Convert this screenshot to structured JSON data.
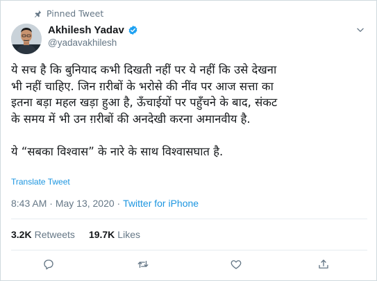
{
  "pinned": {
    "label": "Pinned Tweet",
    "icon": "pin-icon"
  },
  "author": {
    "name": "Akhilesh Yadav",
    "handle": "@yadavakhilesh",
    "verified_icon": "verified-badge-icon",
    "verified_color": "#1da1f2"
  },
  "menu_icon": "chevron-down-icon",
  "tweet": {
    "lines": [
      "ये सच है कि बुनियाद कभी दिखती नहीं पर ये नहीं कि उसे देखना",
      "भी नहीं चाहिए. जिन ग़रीबों के भरोसे की नींव पर आज सत्ता का",
      "इतना बड़ा महल खड़ा हुआ है, ऊँचाईयों पर पहुँचने के बाद, संकट",
      "के समय में भी उन ग़रीबों की अनदेखी करना अमानवीय है.",
      "ये “सबका विश्वास” के नारे के साथ विश्वासघात है."
    ],
    "translate_label": "Translate Tweet"
  },
  "meta": {
    "time": "8:43 AM",
    "separator": " · ",
    "date": "May 13, 2020",
    "source": "Twitter for iPhone"
  },
  "stats": {
    "retweets_count": "3.2K",
    "retweets_label": "Retweets",
    "likes_count": "19.7K",
    "likes_label": "Likes"
  },
  "actions": {
    "reply_icon": "reply-icon",
    "retweet_icon": "retweet-icon",
    "like_icon": "heart-icon",
    "share_icon": "share-icon"
  },
  "colors": {
    "accent": "#1b95e0",
    "muted": "#657786",
    "text": "#14171a"
  }
}
